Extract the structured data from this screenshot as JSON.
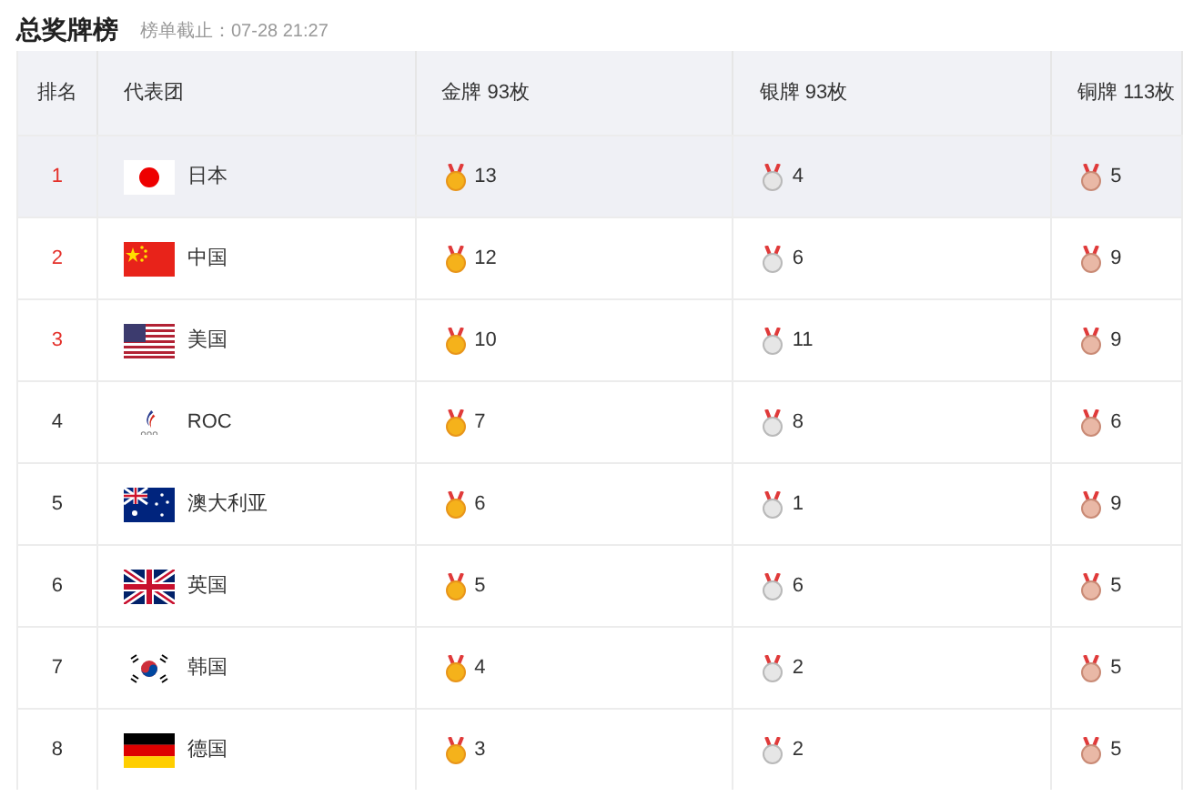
{
  "title": "总奖牌榜",
  "updated": "榜单截止：07-28 21:27",
  "columns": [
    "排名",
    "代表团",
    "金牌 93枚",
    "银牌 93枚",
    "铜牌 113枚"
  ],
  "rows": [
    {
      "rank": "1",
      "kind": "top",
      "selected": true,
      "team": "日本",
      "gold": "13",
      "silver": "4",
      "bronze": "5"
    },
    {
      "rank": "2",
      "kind": "top",
      "selected": false,
      "team": "中国",
      "gold": "12",
      "silver": "6",
      "bronze": "9"
    },
    {
      "rank": "3",
      "kind": "top",
      "selected": false,
      "team": "美国",
      "gold": "10",
      "silver": "11",
      "bronze": "9"
    },
    {
      "rank": "4",
      "kind": "regular",
      "selected": false,
      "team": "ROC",
      "gold": "7",
      "silver": "8",
      "bronze": "6"
    },
    {
      "rank": "5",
      "kind": "regular",
      "selected": false,
      "team": "澳大利亚",
      "gold": "6",
      "silver": "1",
      "bronze": "9"
    },
    {
      "rank": "6",
      "kind": "regular",
      "selected": false,
      "team": "英国",
      "gold": "5",
      "silver": "6",
      "bronze": "5"
    },
    {
      "rank": "7",
      "kind": "regular",
      "selected": false,
      "team": "韩国",
      "gold": "4",
      "silver": "2",
      "bronze": "5"
    },
    {
      "rank": "8",
      "kind": "regular",
      "selected": false,
      "team": "德国",
      "gold": "3",
      "silver": "2",
      "bronze": "5"
    }
  ]
}
